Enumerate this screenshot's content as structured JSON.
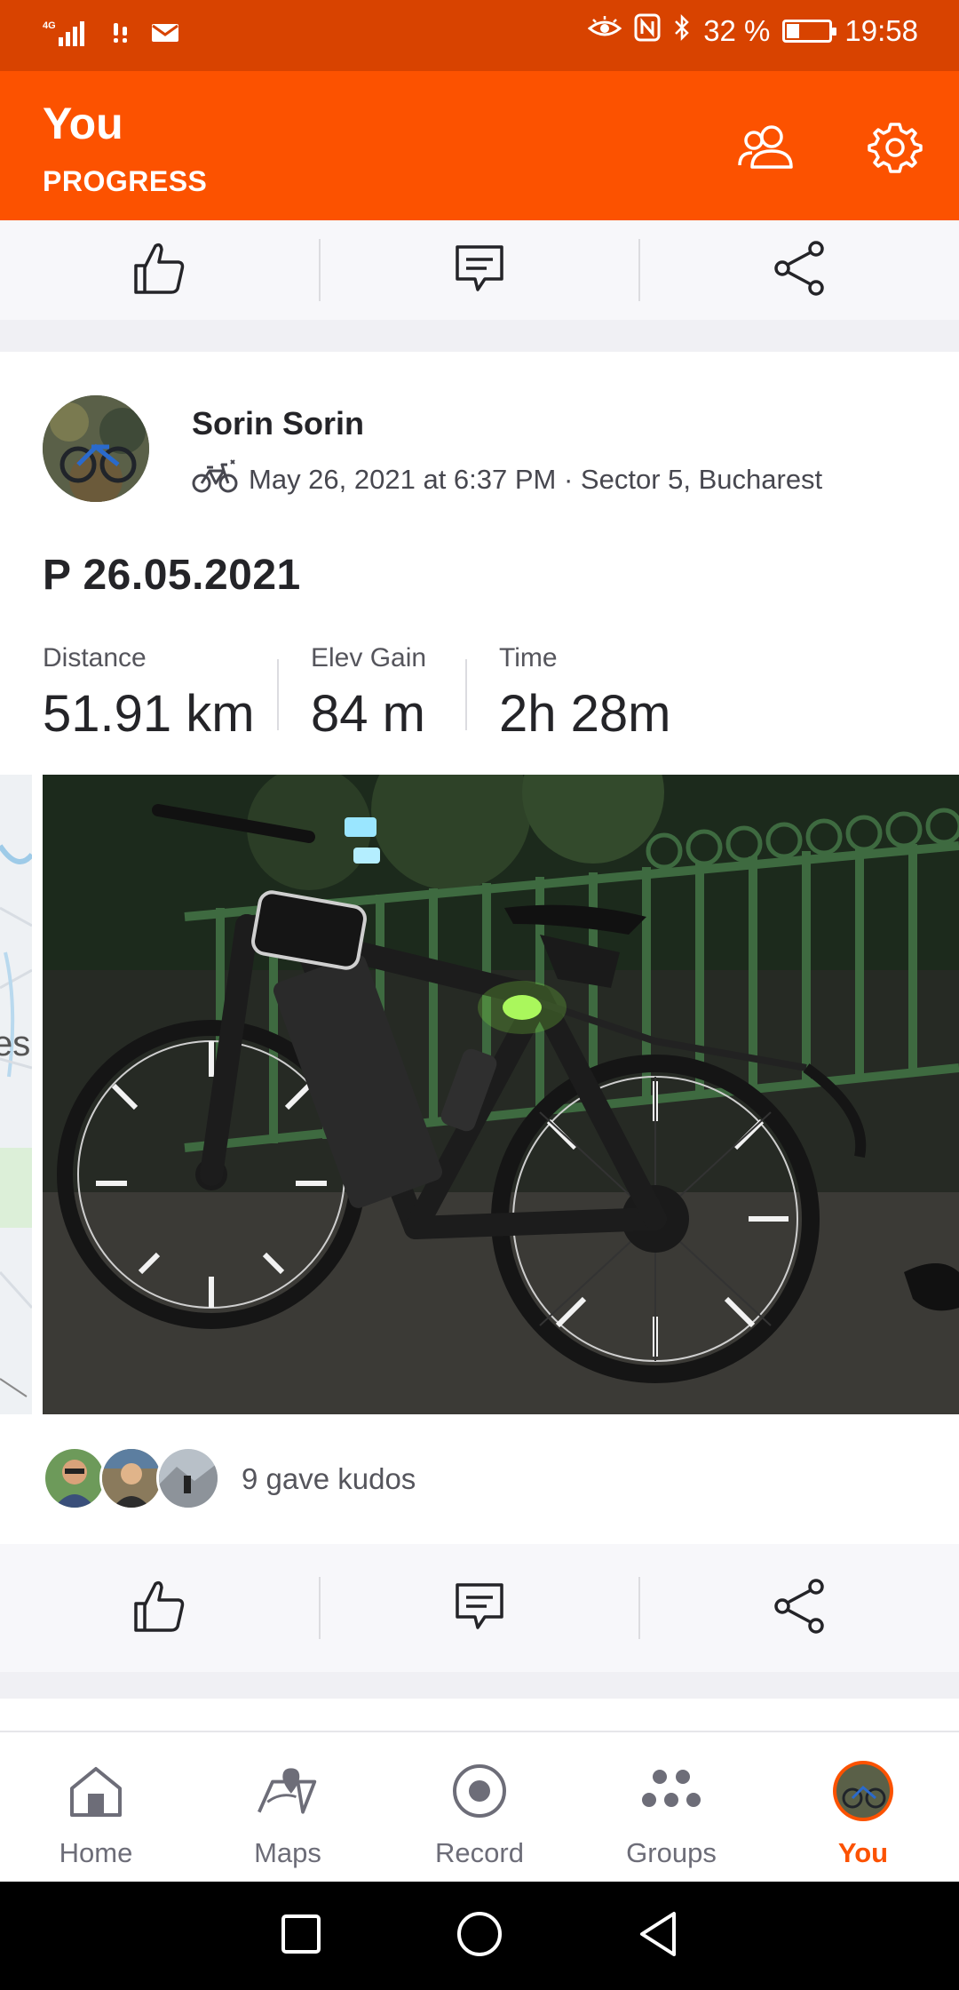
{
  "status_bar": {
    "network": "4G",
    "battery": "32 %",
    "time": "19:58"
  },
  "header": {
    "title": "You",
    "subtitle": "PROGRESS"
  },
  "post": {
    "athlete_name": "Sorin Sorin",
    "meta": "May 26, 2021 at 6:37 PM · Sector 5, Bucharest",
    "activity_title": "P 26.05.2021",
    "stats": [
      {
        "label": "Distance",
        "value": "51.91 km"
      },
      {
        "label": "Elev Gain",
        "value": "84 m"
      },
      {
        "label": "Time",
        "value": "2h 28m"
      }
    ],
    "kudos_text": "9 gave kudos"
  },
  "tabs": [
    {
      "label": "Home",
      "icon": "home-icon"
    },
    {
      "label": "Maps",
      "icon": "maps-icon"
    },
    {
      "label": "Record",
      "icon": "record-icon"
    },
    {
      "label": "Groups",
      "icon": "groups-icon"
    },
    {
      "label": "You",
      "icon": "profile-avatar"
    }
  ],
  "colors": {
    "brand": "#fc5200",
    "status_bar": "#d84300",
    "text_primary": "#242428",
    "text_secondary": "#55555c"
  }
}
